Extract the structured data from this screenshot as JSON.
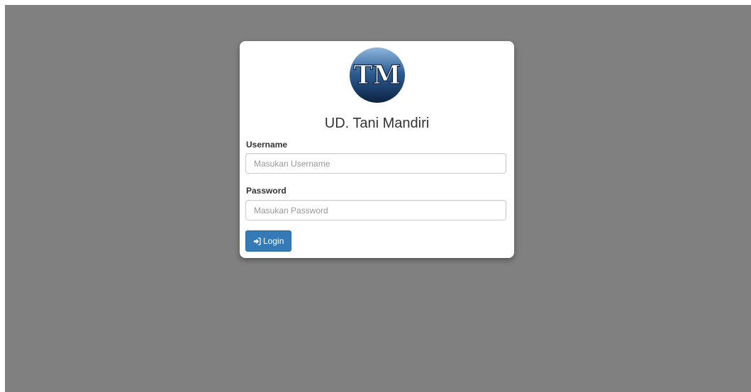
{
  "brand": {
    "logo_text": "TM",
    "title": "UD. Tani Mandiri"
  },
  "form": {
    "username_label": "Username",
    "username_placeholder": "Masukan Username",
    "username_value": "",
    "password_label": "Password",
    "password_placeholder": "Masukan Password",
    "password_value": "",
    "login_label": "Login",
    "login_icon": "sign-in-icon"
  },
  "colors": {
    "background": "#808080",
    "card": "#ffffff",
    "primary_button": "#337ab7",
    "logo_dark": "#0e2a4d",
    "logo_light": "#7fa9d6"
  }
}
